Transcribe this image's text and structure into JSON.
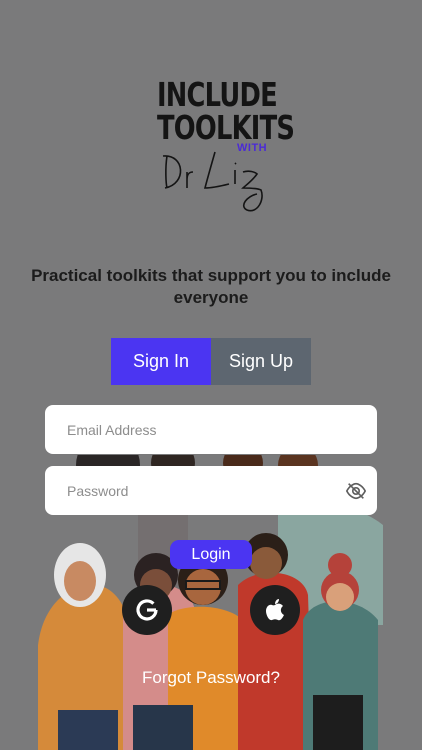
{
  "logo": {
    "line1": "INCLUDE",
    "line2": "TOOLKITS",
    "with": "WITH",
    "signature": "Dr Liz"
  },
  "tagline": "Practical toolkits that support you to include everyone",
  "tabs": {
    "signin": "Sign In",
    "signup": "Sign Up"
  },
  "form": {
    "email_placeholder": "Email Address",
    "password_placeholder": "Password",
    "email_value": "",
    "password_value": ""
  },
  "actions": {
    "login": "Login",
    "forgot": "Forgot Password?"
  },
  "icons": {
    "password_toggle": "eye-off-icon",
    "google": "google-icon",
    "apple": "apple-icon"
  },
  "colors": {
    "background": "#7a7a7b",
    "accent": "#4b35f2",
    "inactive_tab": "#5d6670",
    "social_button": "#1f1f1f"
  }
}
